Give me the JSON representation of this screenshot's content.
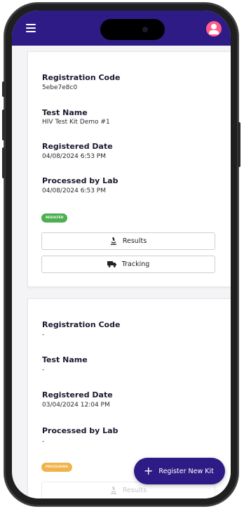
{
  "colors": {
    "brand": "#2f1b86",
    "resulted": "#4caf50",
    "processing": "#f0b24a",
    "avatar": "#ff5c8a"
  },
  "header": {
    "menu_icon": "hamburger-menu-icon",
    "avatar_icon": "user-avatar-icon"
  },
  "kits": [
    {
      "fields": [
        {
          "label": "Registration Code",
          "value": "5ebe7e8c0"
        },
        {
          "label": "Test Name",
          "value": "HIV Test Kit Demo #1"
        },
        {
          "label": "Registered Date",
          "value": "04/08/2024 6:53 PM"
        },
        {
          "label": "Processed by Lab",
          "value": "04/08/2024 6:53 PM"
        }
      ],
      "status": "RESULTED",
      "results_label": "Results",
      "results_icon": "microscope-icon",
      "tracking_label": "Tracking",
      "tracking_icon": "truck-icon"
    },
    {
      "fields": [
        {
          "label": "Registration Code",
          "value": "-"
        },
        {
          "label": "Test Name",
          "value": "-"
        },
        {
          "label": "Registered Date",
          "value": "03/04/2024 12:04 PM"
        },
        {
          "label": "Processed by Lab",
          "value": "-"
        }
      ],
      "status": "PROCESSING",
      "results_label": "Results",
      "results_icon": "microscope-icon"
    }
  ],
  "fab": {
    "label": "Register New Kit",
    "icon": "plus-icon"
  }
}
